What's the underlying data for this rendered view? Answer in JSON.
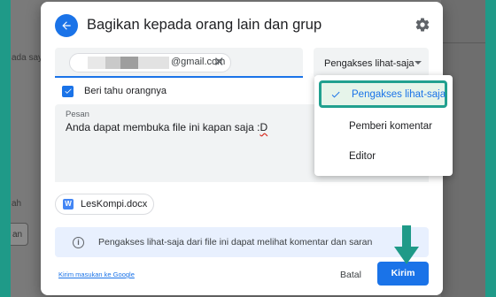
{
  "background": {
    "left_text_1": "ada saya",
    "left_text_2": "ah",
    "left_button": "an"
  },
  "dialog": {
    "title": "Bagikan kepada orang lain dan grup",
    "recipient": {
      "email_suffix": "@gmail.com"
    },
    "role_select": {
      "value": "Pengakses lihat-saja"
    },
    "notify": {
      "label": "Beri tahu orangnya",
      "checked": true
    },
    "message": {
      "label": "Pesan",
      "text_main": "Anda dapat membuka file ini kapan saja :",
      "text_spell": "D"
    },
    "file": {
      "icon_letter": "W",
      "name": "LesKompi.docx"
    },
    "info": {
      "text": "Pengakses lihat-saja dari file ini dapat melihat komentar dan saran"
    },
    "feedback_link": "Kirim masukan ke Google",
    "cancel_label": "Batal",
    "send_label": "Kirim"
  },
  "menu": {
    "items": [
      {
        "label": "Pengakses lihat-saja",
        "selected": true
      },
      {
        "label": "Pemberi komentar",
        "selected": false
      },
      {
        "label": "Editor",
        "selected": false
      }
    ]
  },
  "colors": {
    "accent": "#1a73e8",
    "highlight": "#21a08f",
    "arrow": "#1f9a88"
  }
}
